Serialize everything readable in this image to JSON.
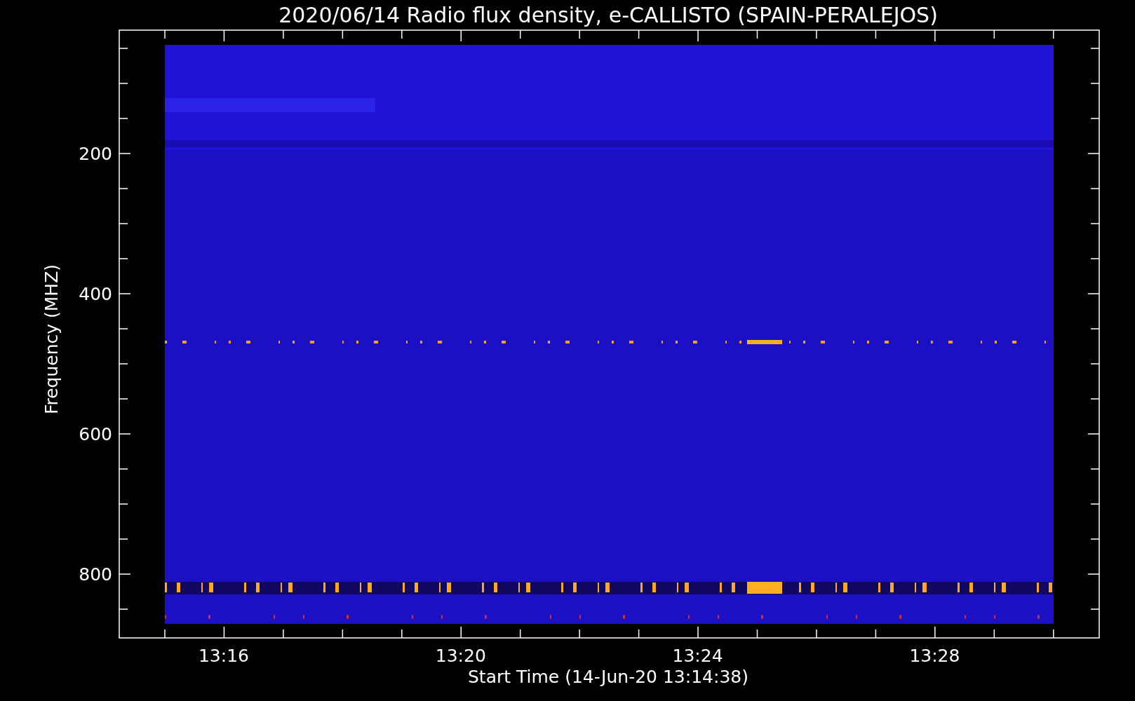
{
  "title": "2020/06/14  Radio flux density, e-CALLISTO (SPAIN-PERALEJOS)",
  "y_axis": {
    "label": "Frequency (MHZ)",
    "ticks": [
      "200",
      "400",
      "600",
      "800"
    ]
  },
  "x_axis": {
    "label": "Start Time (14-Jun-20 13:14:38)",
    "ticks": [
      "13:16",
      "13:20",
      "13:24",
      "13:28"
    ]
  }
}
